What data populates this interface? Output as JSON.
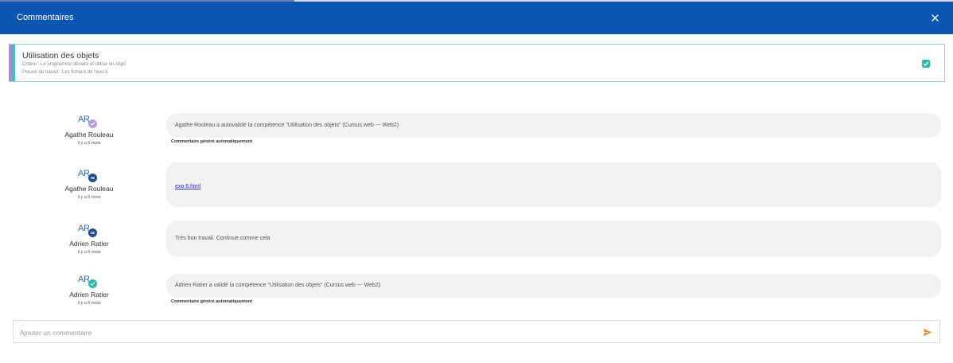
{
  "dialog": {
    "title": "Commentaires",
    "close_icon": "close-icon"
  },
  "competence": {
    "title": "Utilisation des objets",
    "criteria": "Critère : Le programme déclare et utilise un objet",
    "proof": "Preuve de travail : Les fichiers de l'exo 6",
    "validated": true,
    "accent_colors": [
      "#b387d8",
      "#36c4bb"
    ]
  },
  "comments": [
    {
      "initials": "AR",
      "badge": "check-circle-icon",
      "badge_color": "#b89be2",
      "author": "Agathe Rouleau",
      "time": "il y a 6 mois",
      "text": "Agathe Rouleau a autovalidé la compétence \"Utilisation des objets\" (Cursus web --- Web2)",
      "note": "Commentaire généré automatiquement"
    },
    {
      "initials": "AR",
      "badge": "comment-icon",
      "badge_color": "#1e4f8c",
      "author": "Agathe Rouleau",
      "time": "il y a 6 mois",
      "link": "exo 6.html"
    },
    {
      "initials": "AR",
      "badge": "comment-icon",
      "badge_color": "#1e4f8c",
      "author": "Adrien Ratier",
      "time": "il y a 6 mois",
      "text": "Très bon travail. Continue comme cela"
    },
    {
      "initials": "AR",
      "badge": "check-circle-icon",
      "badge_color": "#2bbab0",
      "author": "Adrien Ratier",
      "time": "il y a 6 mois",
      "text": "Adrien Ratier a validé la compétence \"Utilisation des objets\" (Cursus web --- Web2)",
      "note": "Commentaire généré automatiquement"
    }
  ],
  "input": {
    "placeholder": "Ajouter un commentaire",
    "value": "",
    "send_icon": "send-icon"
  },
  "colors": {
    "header": "#0c55b0",
    "send": "#e58a3a"
  }
}
